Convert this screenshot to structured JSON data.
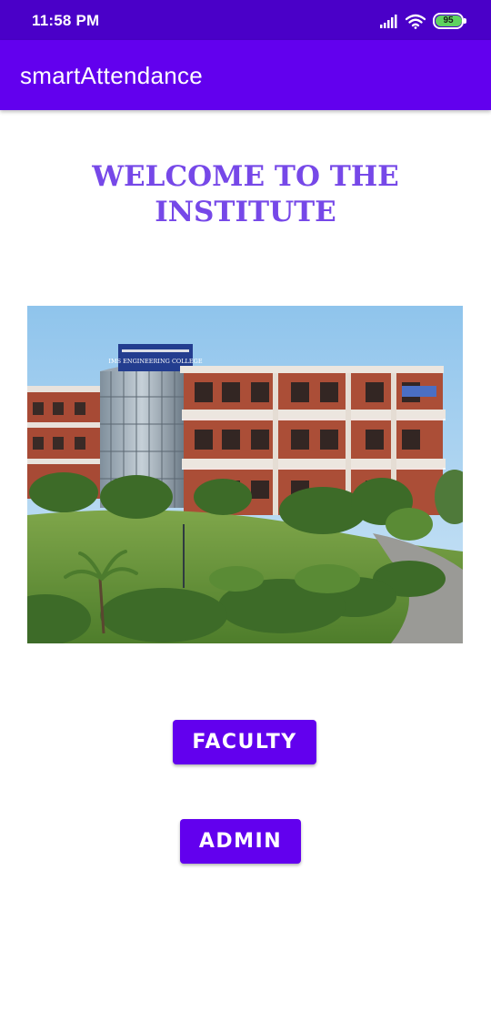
{
  "status_bar": {
    "time": "11:58 PM",
    "battery_level": "95",
    "icons": [
      "signal-icon",
      "wifi-icon",
      "battery-icon"
    ]
  },
  "app_bar": {
    "title": "smartAttendance"
  },
  "main": {
    "welcome_text": "WELCOME TO THE INSTITUTE",
    "image": {
      "subject": "campus-building-photo",
      "building_sign": "IMS ENGINEERING COLLEGE"
    },
    "buttons": {
      "faculty_label": "FACULTY",
      "admin_label": "ADMIN"
    }
  },
  "colors": {
    "status_bar": "#4a00c8",
    "primary": "#6200ee",
    "welcome_text": "#7648e8",
    "battery_fill": "#5ed35f"
  }
}
